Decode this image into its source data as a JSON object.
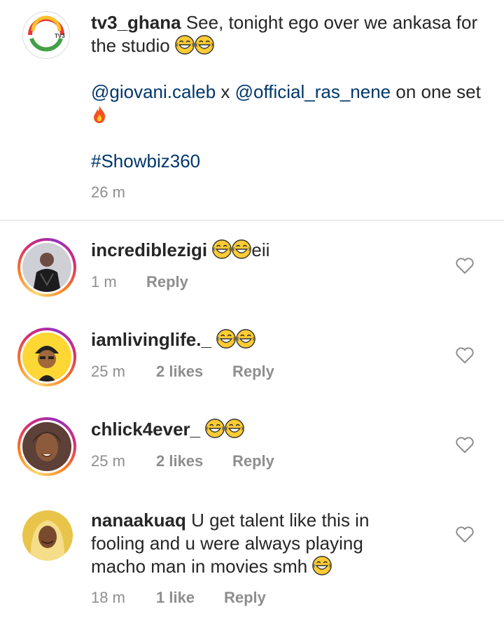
{
  "caption": {
    "username": "tv3_ghana",
    "text_line1": "See, tonight ego over we ankasa for the studio",
    "mention1": "@giovani.caleb",
    "connector": "x",
    "mention2": "@official_ras_nene",
    "text_line2a": "on",
    "text_line2b": "one set",
    "hashtag": "#Showbiz360",
    "timestamp": "26 m",
    "logo_text": "TV3"
  },
  "comments": [
    {
      "username": "incrediblezigi",
      "text": "eii",
      "time": "1 m",
      "likes": "",
      "reply": "Reply",
      "emoji_count": 2
    },
    {
      "username": "iamlivinglife._",
      "text": "",
      "time": "25 m",
      "likes": "2 likes",
      "reply": "Reply",
      "emoji_count": 2
    },
    {
      "username": "chlick4ever_",
      "text": "",
      "time": "25 m",
      "likes": "2 likes",
      "reply": "Reply",
      "emoji_count": 2
    },
    {
      "username": "nanaakuaq",
      "text": "U get talent like this in fooling and u were always playing macho man in movies smh",
      "time": "18 m",
      "likes": "1 like",
      "reply": "Reply",
      "emoji_count": 1
    }
  ],
  "colors": {
    "link": "#00376b",
    "meta": "#8e8e8e",
    "divider": "#dbdbdb",
    "text": "#262626"
  },
  "icons": [
    "laughing-emoji",
    "fire-emoji",
    "heart-outline-icon"
  ]
}
